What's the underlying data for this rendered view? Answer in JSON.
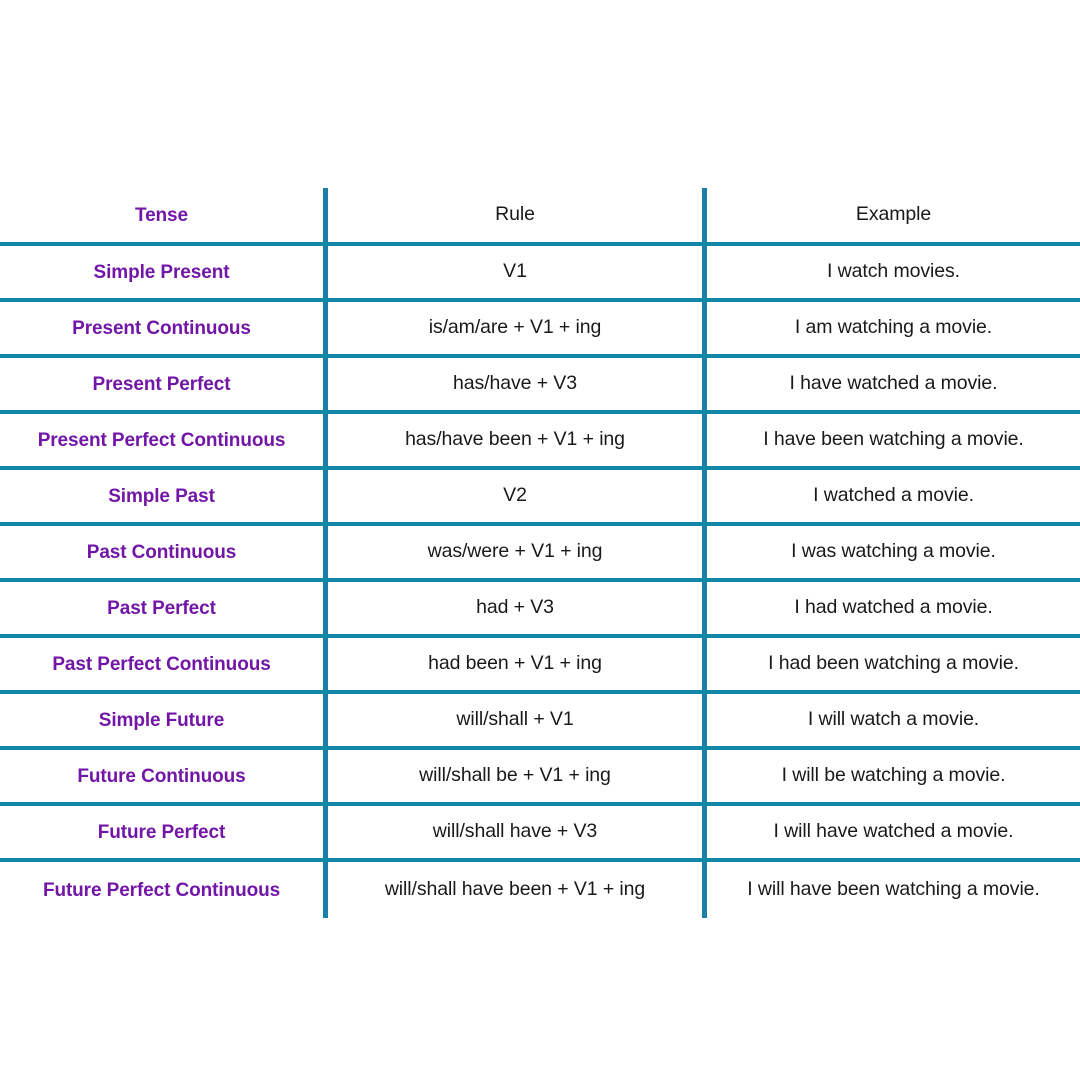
{
  "colors": {
    "header_text": "#1d3fbf",
    "tense_text": "#7216a8",
    "body_text": "#1a1a1a",
    "rule_line": "#1188a5",
    "vertical_line": "#1b7fa8",
    "background": "#ffffff"
  },
  "table": {
    "headers": {
      "tense": "Tense",
      "rule": "Rule",
      "example": "Example"
    },
    "rows": [
      {
        "tense": "Simple Present",
        "rule": "V1",
        "example": "I watch movies."
      },
      {
        "tense": "Present Continuous",
        "rule": "is/am/are + V1 + ing",
        "example": "I am watching a movie."
      },
      {
        "tense": "Present Perfect",
        "rule": "has/have + V3",
        "example": "I have watched a movie."
      },
      {
        "tense": "Present Perfect Continuous",
        "rule": "has/have been + V1 + ing",
        "example": "I have been watching a movie."
      },
      {
        "tense": "Simple Past",
        "rule": "V2",
        "example": "I watched a movie."
      },
      {
        "tense": "Past Continuous",
        "rule": "was/were + V1 + ing",
        "example": "I was watching a movie."
      },
      {
        "tense": "Past Perfect",
        "rule": "had + V3",
        "example": "I had watched a movie."
      },
      {
        "tense": "Past Perfect Continuous",
        "rule": "had been + V1 + ing",
        "example": "I had been watching a movie."
      },
      {
        "tense": "Simple Future",
        "rule": "will/shall + V1",
        "example": "I will watch a movie."
      },
      {
        "tense": "Future Continuous",
        "rule": "will/shall be + V1 + ing",
        "example": "I will be watching a movie."
      },
      {
        "tense": "Future Perfect",
        "rule": "will/shall have + V3",
        "example": "I will have watched a movie."
      },
      {
        "tense": "Future Perfect Continuous",
        "rule": "will/shall have been + V1 + ing",
        "example": "I will have been watching a movie."
      }
    ]
  }
}
